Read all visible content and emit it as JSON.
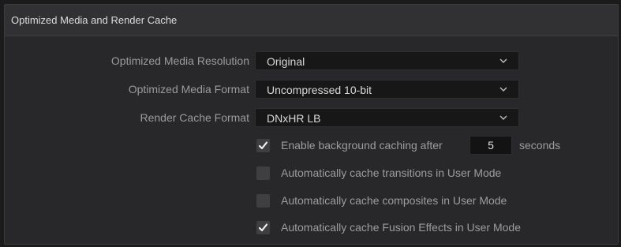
{
  "panel": {
    "title": "Optimized Media and Render Cache"
  },
  "settings": {
    "optimized_media_resolution": {
      "label": "Optimized Media Resolution",
      "value": "Original"
    },
    "optimized_media_format": {
      "label": "Optimized Media Format",
      "value": "Uncompressed 10-bit"
    },
    "render_cache_format": {
      "label": "Render Cache Format",
      "value": "DNxHR LB"
    }
  },
  "checkboxes": {
    "background_caching": {
      "label": "Enable background caching after",
      "checked": true,
      "seconds_value": "5",
      "suffix": "seconds"
    },
    "cache_transitions": {
      "label": "Automatically cache transitions in User Mode",
      "checked": false
    },
    "cache_composites": {
      "label": "Automatically cache composites in User Mode",
      "checked": false
    },
    "cache_fusion": {
      "label": "Automatically cache Fusion Effects in User Mode",
      "checked": true
    }
  },
  "icons": {
    "dropdown": "chevron-down-icon",
    "check": "checkmark-icon"
  },
  "colors": {
    "panel_bg": "#29292b",
    "header_bg": "#313133",
    "field_bg": "#171718",
    "checkbox_bg": "#3f3f42",
    "label_text": "#9b9b9b",
    "value_text": "#d8d8d8"
  }
}
